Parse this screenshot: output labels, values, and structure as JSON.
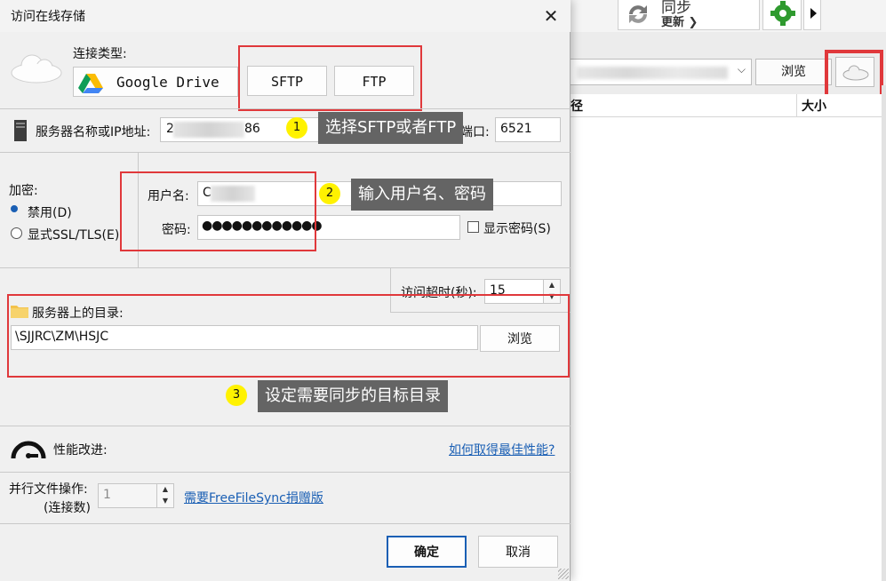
{
  "bg": {
    "sync_label": "同步",
    "update_label": "更新 ❯",
    "path_caret": "⌵",
    "browse": "浏览",
    "col_path": "径",
    "col_size": "大小"
  },
  "dialog": {
    "title": "访问在线存储",
    "close": "✕",
    "connection_type_label": "连接类型:",
    "types": {
      "gdrive": "Google Drive",
      "sftp": "SFTP",
      "ftp": "FTP"
    },
    "server_label": "服务器名称或IP地址:",
    "server_value_prefix": "2",
    "server_value_suffix": "86",
    "port_label": "端口:",
    "port_value": "6521",
    "encryption_label": "加密:",
    "encryption_options": [
      "禁用(D)",
      "显式SSL/TLS(E)"
    ],
    "username_label": "用户名:",
    "username_value": "C",
    "password_label": "密码:",
    "password_value": "●●●●●●●●●●●●",
    "show_password_label": "显示密码(S)",
    "timeout_label": "访问超时(秒):",
    "timeout_value": "15",
    "dir_label": "服务器上的目录:",
    "dir_value": "\\SJJRC\\ZM\\HSJC",
    "dir_browse": "浏览",
    "perf_label": "性能改进:",
    "perf_link": "如何取得最佳性能?",
    "parallel_label_1": "并行文件操作:",
    "parallel_label_2": "(连接数)",
    "parallel_value": "1",
    "donation_link": "需要FreeFileSync捐赠版",
    "ok": "确定",
    "cancel": "取消"
  },
  "callouts": [
    {
      "num": "1",
      "text": "选择SFTP或者FTP"
    },
    {
      "num": "2",
      "text": "输入用户名、密码"
    },
    {
      "num": "3",
      "text": "设定需要同步的目标目录"
    }
  ],
  "colors": {
    "highlight": "#e0383b",
    "callout_bg": "#646464",
    "callout_num": "#fff200",
    "link": "#1a5fb4"
  }
}
